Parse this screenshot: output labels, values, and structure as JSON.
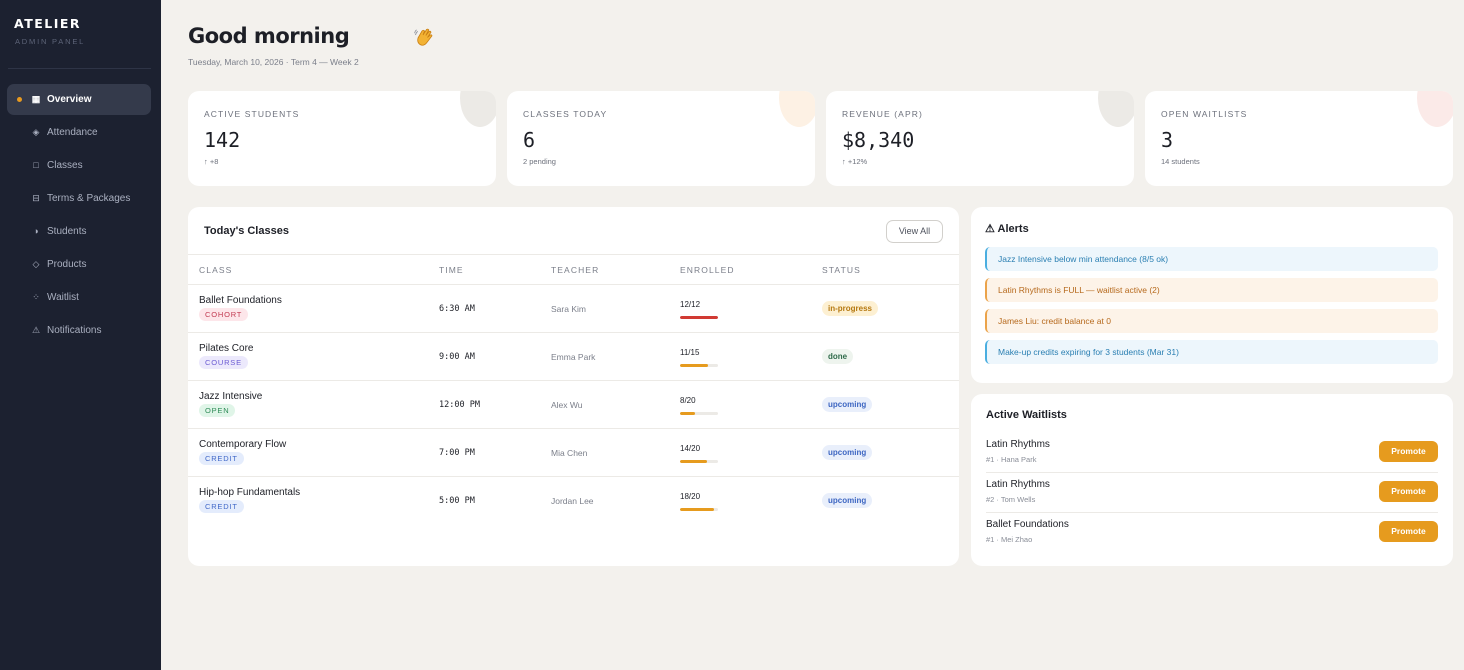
{
  "brand": {
    "name": "ATELIER",
    "subtitle": "ADMIN PANEL"
  },
  "nav": [
    {
      "label": "Overview",
      "icon": "grid-icon",
      "glyph": "▦",
      "active": true
    },
    {
      "label": "Attendance",
      "icon": "diamond-icon",
      "glyph": "◈",
      "active": false
    },
    {
      "label": "Classes",
      "icon": "square-icon",
      "glyph": "□",
      "active": false
    },
    {
      "label": "Terms & Packages",
      "icon": "layout-icon",
      "glyph": "⊟",
      "active": false
    },
    {
      "label": "Students",
      "icon": "half-circle-icon",
      "glyph": "◑",
      "active": false
    },
    {
      "label": "Products",
      "icon": "diamond-outline-icon",
      "glyph": "◇",
      "active": false
    },
    {
      "label": "Waitlist",
      "icon": "dots-icon",
      "glyph": "⁘",
      "active": false
    },
    {
      "label": "Notifications",
      "icon": "warning-icon",
      "glyph": "⚠",
      "active": false
    }
  ],
  "header": {
    "greeting": "Good morning",
    "date_line": "Tuesday, March 10, 2026 · Term 4 — Week 2"
  },
  "stats": [
    {
      "label": "ACTIVE STUDENTS",
      "value": "142",
      "sub": "↑ +8",
      "accent": "#eceae6"
    },
    {
      "label": "CLASSES TODAY",
      "value": "6",
      "sub": "2 pending",
      "accent": "#fdf1e4"
    },
    {
      "label": "REVENUE (APR)",
      "value": "$8,340",
      "sub": "↑ +12%",
      "accent": "#eceae6"
    },
    {
      "label": "OPEN WAITLISTS",
      "value": "3",
      "sub": "14 students",
      "accent": "#fbeae8"
    }
  ],
  "classes": {
    "title": "Today's Classes",
    "view_all": "View All",
    "columns": [
      "CLASS",
      "TIME",
      "TEACHER",
      "ENROLLED",
      "STATUS"
    ],
    "rows": [
      {
        "name": "Ballet Foundations",
        "tag": "COHORT",
        "tag_type": "cohort",
        "time": "6:30 AM",
        "teacher": "Sara Kim",
        "enrolled": "12/12",
        "fill": 1.0,
        "bar_color": "#d13a33",
        "status": "in-progress",
        "status_type": "progress"
      },
      {
        "name": "Pilates Core",
        "tag": "COURSE",
        "tag_type": "course",
        "time": "9:00 AM",
        "teacher": "Emma Park",
        "enrolled": "11/15",
        "fill": 0.733,
        "bar_color": "#e69b1e",
        "status": "done",
        "status_type": "done"
      },
      {
        "name": "Jazz Intensive",
        "tag": "OPEN",
        "tag_type": "open",
        "time": "12:00 PM",
        "teacher": "Alex Wu",
        "enrolled": "8/20",
        "fill": 0.4,
        "bar_color": "#e69b1e",
        "status": "upcoming",
        "status_type": "upcoming"
      },
      {
        "name": "Contemporary Flow",
        "tag": "CREDIT",
        "tag_type": "credit",
        "time": "7:00 PM",
        "teacher": "Mia Chen",
        "enrolled": "14/20",
        "fill": 0.7,
        "bar_color": "#e69b1e",
        "status": "upcoming",
        "status_type": "upcoming"
      },
      {
        "name": "Hip-hop Fundamentals",
        "tag": "CREDIT",
        "tag_type": "credit",
        "time": "5:00 PM",
        "teacher": "Jordan Lee",
        "enrolled": "18/20",
        "fill": 0.9,
        "bar_color": "#e69b1e",
        "status": "upcoming",
        "status_type": "upcoming"
      }
    ]
  },
  "alerts": {
    "title": "⚠ Alerts",
    "items": [
      {
        "text": "Jazz Intensive below min attendance (8/5 ok)",
        "type": "blue"
      },
      {
        "text": "Latin Rhythms is FULL — waitlist active (2)",
        "type": "orange"
      },
      {
        "text": "James Liu: credit balance at 0",
        "type": "orange"
      },
      {
        "text": "Make-up credits expiring for 3 students (Mar 31)",
        "type": "blue"
      }
    ]
  },
  "waitlists": {
    "title": "Active Waitlists",
    "items": [
      {
        "class": "Latin Rhythms",
        "meta": "#1 · Hana Park",
        "action": "Promote"
      },
      {
        "class": "Latin Rhythms",
        "meta": "#2 · Tom Wells",
        "action": "Promote"
      },
      {
        "class": "Ballet Foundations",
        "meta": "#1 · Mei Zhao",
        "action": "Promote"
      }
    ]
  }
}
